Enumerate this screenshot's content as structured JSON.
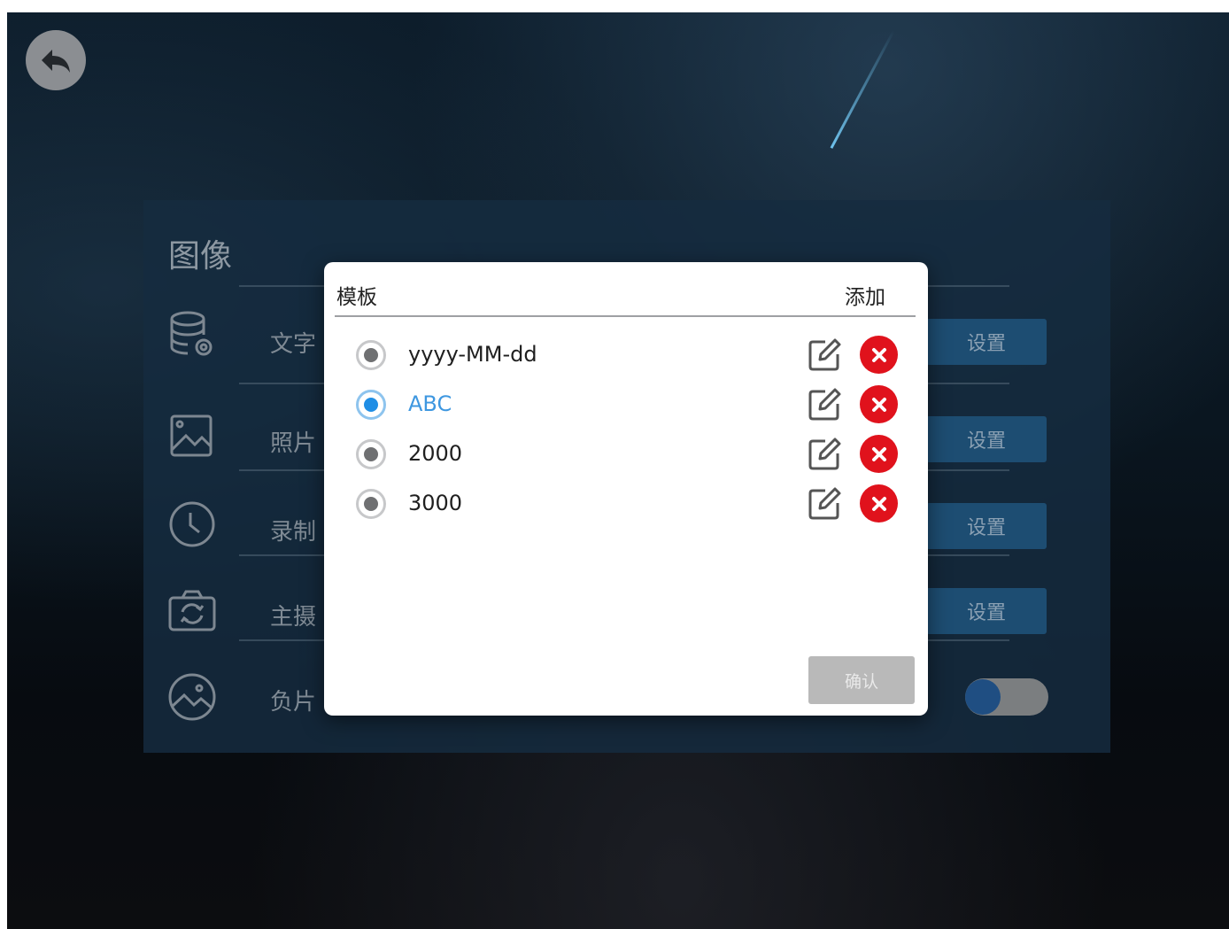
{
  "panel": {
    "title": "图像",
    "rows": [
      {
        "label": "文字",
        "icon": "database-icon",
        "setting_label": "设置"
      },
      {
        "label": "照片",
        "icon": "image-icon",
        "setting_label": "设置"
      },
      {
        "label": "录制",
        "icon": "clock-icon",
        "setting_label": "设置"
      },
      {
        "label": "主摄",
        "icon": "camera-switch-icon",
        "setting_label": "设置"
      },
      {
        "label": "负片",
        "icon": "picture-circle-icon",
        "toggle": "off"
      }
    ]
  },
  "dialog": {
    "title": "模板",
    "add_label": "添加",
    "options": [
      {
        "label": "yyyy-MM-dd",
        "selected": false
      },
      {
        "label": "ABC",
        "selected": true
      },
      {
        "label": "2000",
        "selected": false
      },
      {
        "label": "3000",
        "selected": false
      }
    ],
    "confirm_label": "确认"
  },
  "colors": {
    "selected_accent": "#1f8ee5",
    "delete_red": "#e0121c",
    "setting_button": "#1d4d72"
  }
}
